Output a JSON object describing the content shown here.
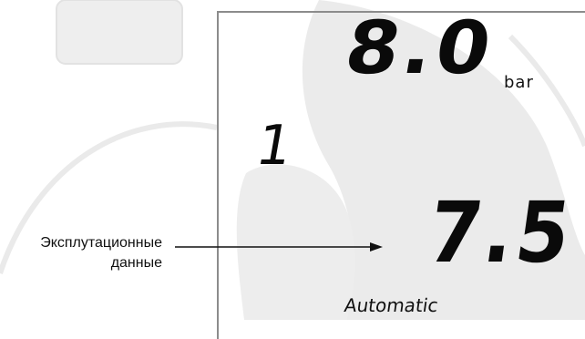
{
  "display": {
    "main_value": "8.0",
    "unit": "bar",
    "indicator_digit": "1",
    "sub_value": "7.5",
    "mode": "Automatic"
  },
  "callout": {
    "line1": "Эксплутационные",
    "line2": "данные"
  },
  "colors": {
    "watermark": "#ececec",
    "text": "#0a0a0a",
    "panel_outline": "#8c8c8c"
  }
}
